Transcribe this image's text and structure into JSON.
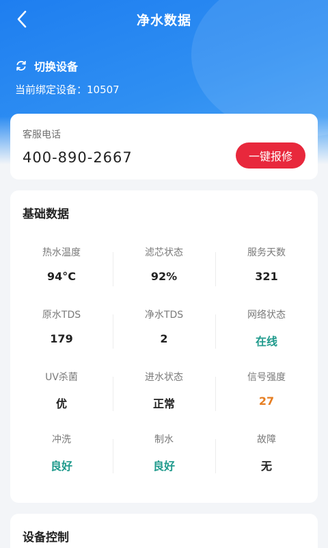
{
  "header": {
    "title": "净水数据",
    "switch_device_label": "切换设备",
    "bound_device_text": "当前绑定设备：10507"
  },
  "service": {
    "label": "客服电话",
    "phone": "400-890-2667",
    "repair_button": "一键报修"
  },
  "basic": {
    "title": "基础数据",
    "items": [
      {
        "label": "热水温度",
        "value": "94°C"
      },
      {
        "label": "滤芯状态",
        "value": "92%"
      },
      {
        "label": "服务天数",
        "value": "321"
      },
      {
        "label": "原水TDS",
        "value": "179"
      },
      {
        "label": "净水TDS",
        "value": "2"
      },
      {
        "label": "网络状态",
        "value": "在线"
      },
      {
        "label": "UV杀菌",
        "value": "优"
      },
      {
        "label": "进水状态",
        "value": "正常"
      },
      {
        "label": "信号强度",
        "value": "27"
      },
      {
        "label": "冲洗",
        "value": "良好"
      },
      {
        "label": "制水",
        "value": "良好"
      },
      {
        "label": "故障",
        "value": "无"
      }
    ]
  },
  "control": {
    "title": "设备控制"
  },
  "colors": {
    "primary": "#1e7ef0",
    "repair": "#e8283c",
    "ok": "#1f9a8c",
    "warn": "#e67e22"
  },
  "icons": {
    "back": "chevron-left-icon",
    "switch": "refresh-icon"
  }
}
